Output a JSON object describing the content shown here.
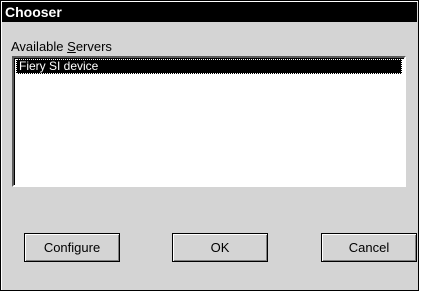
{
  "window": {
    "title": "Chooser"
  },
  "servers": {
    "label_prefix": "Available ",
    "label_accel": "S",
    "label_suffix": "ervers",
    "items": [
      {
        "label": "Fiery SI device",
        "selected": true
      }
    ]
  },
  "buttons": {
    "configure": "Configure",
    "ok": "OK",
    "cancel": "Cancel"
  }
}
